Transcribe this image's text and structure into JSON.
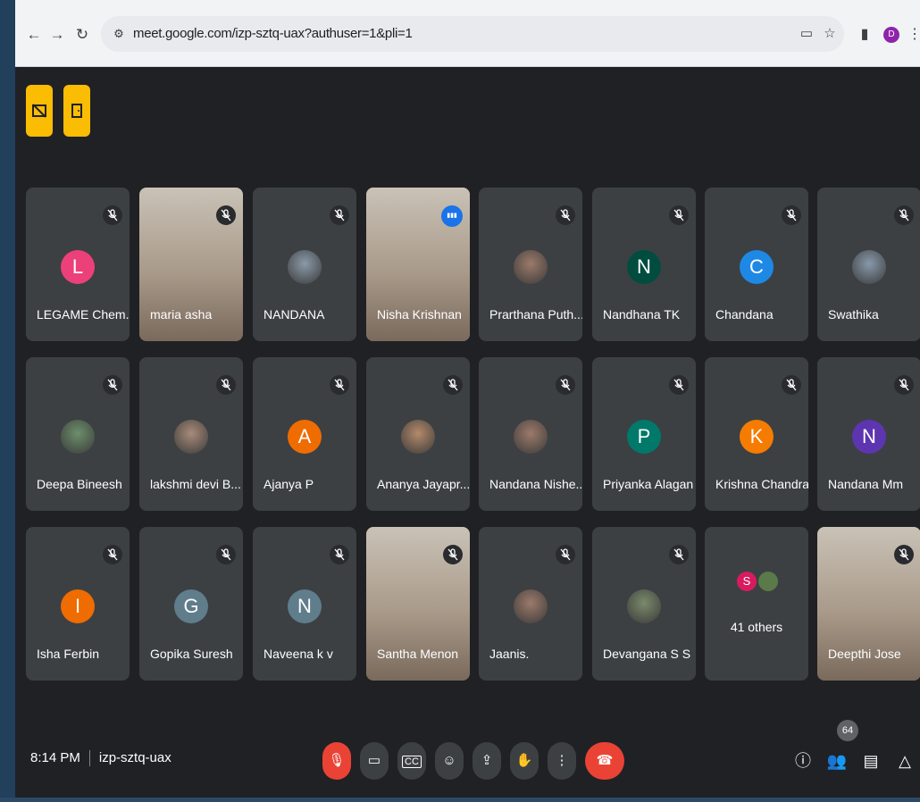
{
  "browser": {
    "url": "meet.google.com/izp-sztq-uax?authuser=1&pli=1",
    "profile_initial": "D"
  },
  "meeting": {
    "time": "8:14 PM",
    "code": "izp-sztq-uax",
    "participant_count": "64"
  },
  "participants": [
    {
      "name": "LEGAME Chem...",
      "initial": "L",
      "color": "#ec407a",
      "kind": "initial"
    },
    {
      "name": "maria asha",
      "kind": "video"
    },
    {
      "name": "NANDANA",
      "kind": "photo"
    },
    {
      "name": "Nisha Krishnan",
      "kind": "video",
      "speaking": true
    },
    {
      "name": "Prarthana Puth...",
      "kind": "photo"
    },
    {
      "name": "Nandhana TK",
      "initial": "N",
      "color": "#004d40",
      "kind": "initial"
    },
    {
      "name": "Chandana",
      "initial": "C",
      "color": "#1e88e5",
      "kind": "initial"
    },
    {
      "name": "Swathika",
      "kind": "photo"
    },
    {
      "name": "Deepa Bineesh",
      "kind": "photo"
    },
    {
      "name": "lakshmi devi B...",
      "kind": "photo"
    },
    {
      "name": "Ajanya P",
      "initial": "A",
      "color": "#ef6c00",
      "kind": "initial"
    },
    {
      "name": "Ananya Jayapr...",
      "kind": "photo"
    },
    {
      "name": "Nandana Nishe...",
      "kind": "photo"
    },
    {
      "name": "Priyanka Alagan",
      "initial": "P",
      "color": "#00796b",
      "kind": "initial"
    },
    {
      "name": "Krishna Chandra",
      "initial": "K",
      "color": "#f57c00",
      "kind": "initial"
    },
    {
      "name": "Nandana Mm",
      "initial": "N",
      "color": "#5e35b1",
      "kind": "initial"
    },
    {
      "name": "Isha Ferbin",
      "initial": "I",
      "color": "#ef6c00",
      "kind": "initial"
    },
    {
      "name": "Gopika Suresh",
      "initial": "G",
      "color": "#607d8b",
      "kind": "initial"
    },
    {
      "name": "Naveena k v",
      "initial": "N",
      "color": "#607d8b",
      "kind": "initial"
    },
    {
      "name": "Santha Menon",
      "kind": "video"
    },
    {
      "name": "Jaanis.",
      "kind": "photo"
    },
    {
      "name": "Devangana S S",
      "kind": "photo"
    },
    {
      "name": "41 others",
      "kind": "others",
      "initial": "S",
      "color": "#d81b60"
    },
    {
      "name": "Deepthi Jose",
      "kind": "video"
    }
  ],
  "icons": {
    "back": "back-arrow-icon",
    "forward": "forward-arrow-icon",
    "reload": "reload-icon",
    "mic": "mic-off-icon",
    "camera": "camera-icon",
    "captions": "captions-icon",
    "emoji": "emoji-icon",
    "present": "present-icon",
    "hand": "raise-hand-icon",
    "more": "more-options-icon",
    "end": "end-call-icon",
    "info": "info-icon",
    "people": "people-icon",
    "chat": "chat-icon",
    "activities": "activities-icon"
  },
  "colors": {
    "accent_yellow": "#fbbc04",
    "end_call": "#ea4335",
    "active_border": "#8ab4f8"
  }
}
